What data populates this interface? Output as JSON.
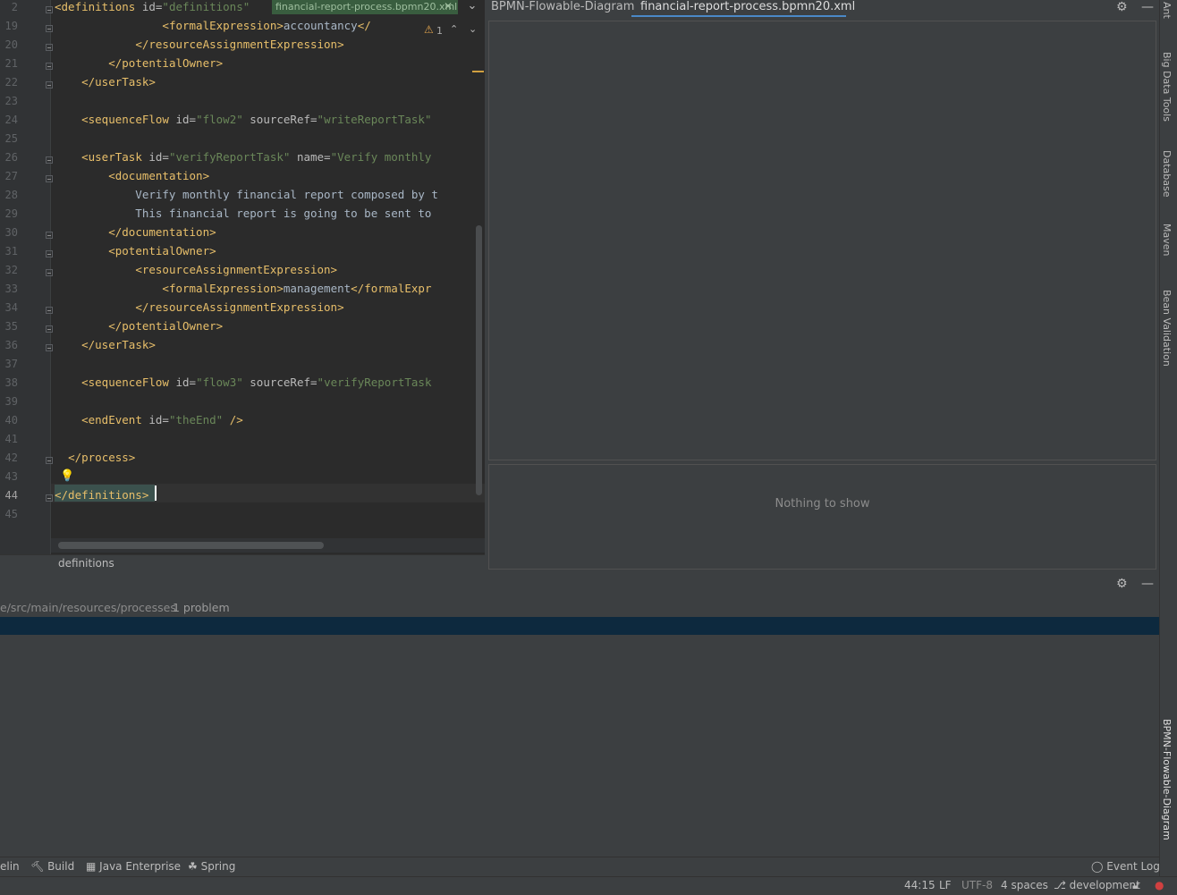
{
  "editor": {
    "tab_label": "financial-report-process.bpmn20.xml",
    "warning_count": "1",
    "lines": [
      {
        "n": "2",
        "parts": [
          [
            "tag",
            "<definitions"
          ],
          [
            "attr",
            " id="
          ],
          [
            "val",
            "\"definitions\""
          ]
        ]
      },
      {
        "n": "19",
        "parts": [
          [
            "txt",
            "                "
          ],
          [
            "tag",
            "<formalExpression>"
          ],
          [
            "txt",
            "accountancy"
          ],
          [
            "tag",
            "</"
          ]
        ]
      },
      {
        "n": "20",
        "parts": [
          [
            "txt",
            "            "
          ],
          [
            "tag",
            "</resourceAssignmentExpression>"
          ]
        ]
      },
      {
        "n": "21",
        "parts": [
          [
            "txt",
            "        "
          ],
          [
            "tag",
            "</potentialOwner>"
          ]
        ]
      },
      {
        "n": "22",
        "parts": [
          [
            "txt",
            "    "
          ],
          [
            "tag",
            "</userTask>"
          ]
        ]
      },
      {
        "n": "23",
        "parts": []
      },
      {
        "n": "24",
        "parts": [
          [
            "txt",
            "    "
          ],
          [
            "tag",
            "<sequenceFlow"
          ],
          [
            "attr",
            " id="
          ],
          [
            "val",
            "\"flow2\""
          ],
          [
            "attr",
            " sourceRef="
          ],
          [
            "val",
            "\"writeReportTask\""
          ]
        ]
      },
      {
        "n": "25",
        "parts": []
      },
      {
        "n": "26",
        "parts": [
          [
            "txt",
            "    "
          ],
          [
            "tag",
            "<userTask"
          ],
          [
            "attr",
            " id="
          ],
          [
            "val",
            "\"verifyReportTask\""
          ],
          [
            "attr",
            " name="
          ],
          [
            "val",
            "\"Verify monthly"
          ]
        ]
      },
      {
        "n": "27",
        "parts": [
          [
            "txt",
            "        "
          ],
          [
            "tag",
            "<documentation>"
          ]
        ]
      },
      {
        "n": "28",
        "parts": [
          [
            "txt",
            "            Verify monthly financial report composed by t"
          ]
        ]
      },
      {
        "n": "29",
        "parts": [
          [
            "txt",
            "            This financial report is going to be sent to"
          ]
        ]
      },
      {
        "n": "30",
        "parts": [
          [
            "txt",
            "        "
          ],
          [
            "tag",
            "</documentation>"
          ]
        ]
      },
      {
        "n": "31",
        "parts": [
          [
            "txt",
            "        "
          ],
          [
            "tag",
            "<potentialOwner>"
          ]
        ]
      },
      {
        "n": "32",
        "parts": [
          [
            "txt",
            "            "
          ],
          [
            "tag",
            "<resourceAssignmentExpression>"
          ]
        ]
      },
      {
        "n": "33",
        "parts": [
          [
            "txt",
            "                "
          ],
          [
            "tag",
            "<formalExpression>"
          ],
          [
            "txt",
            "management"
          ],
          [
            "tag",
            "</formalExpr"
          ]
        ]
      },
      {
        "n": "34",
        "parts": [
          [
            "txt",
            "            "
          ],
          [
            "tag",
            "</resourceAssignmentExpression>"
          ]
        ]
      },
      {
        "n": "35",
        "parts": [
          [
            "txt",
            "        "
          ],
          [
            "tag",
            "</potentialOwner>"
          ]
        ]
      },
      {
        "n": "36",
        "parts": [
          [
            "txt",
            "    "
          ],
          [
            "tag",
            "</userTask>"
          ]
        ]
      },
      {
        "n": "37",
        "parts": []
      },
      {
        "n": "38",
        "parts": [
          [
            "txt",
            "    "
          ],
          [
            "tag",
            "<sequenceFlow"
          ],
          [
            "attr",
            " id="
          ],
          [
            "val",
            "\"flow3\""
          ],
          [
            "attr",
            " sourceRef="
          ],
          [
            "val",
            "\"verifyReportTask"
          ]
        ]
      },
      {
        "n": "39",
        "parts": []
      },
      {
        "n": "40",
        "parts": [
          [
            "txt",
            "    "
          ],
          [
            "tag",
            "<endEvent"
          ],
          [
            "attr",
            " id="
          ],
          [
            "val",
            "\"theEnd\""
          ],
          [
            "tag",
            " />"
          ]
        ]
      },
      {
        "n": "41",
        "parts": []
      },
      {
        "n": "42",
        "parts": [
          [
            "txt",
            "  "
          ],
          [
            "tag",
            "</process>"
          ]
        ]
      },
      {
        "n": "43",
        "parts": []
      },
      {
        "n": "44",
        "parts": [
          [
            "tag",
            "</definitions>"
          ]
        ]
      },
      {
        "n": "45",
        "parts": []
      }
    ],
    "breadcrumb": "definitions"
  },
  "right_panel": {
    "tabs": [
      "BPMN-Flowable-Diagram",
      "financial-report-process.bpmn20.xml"
    ],
    "empty_message": "Nothing to show"
  },
  "side_stripe": [
    "Ant",
    "Big Data Tools",
    "Database",
    "Maven",
    "Bean Validation",
    "BPMN-Flowable-Diagram"
  ],
  "problems": {
    "path": "e/src/main/resources/processes",
    "count": "1 problem"
  },
  "toolbar": {
    "items": [
      "elin",
      "Build",
      "Java Enterprise",
      "Spring"
    ],
    "event_log": "Event Log"
  },
  "status": {
    "position": "44:15",
    "line_sep": "LF",
    "encoding": "UTF-8",
    "indent": "4 spaces",
    "branch": "development"
  }
}
